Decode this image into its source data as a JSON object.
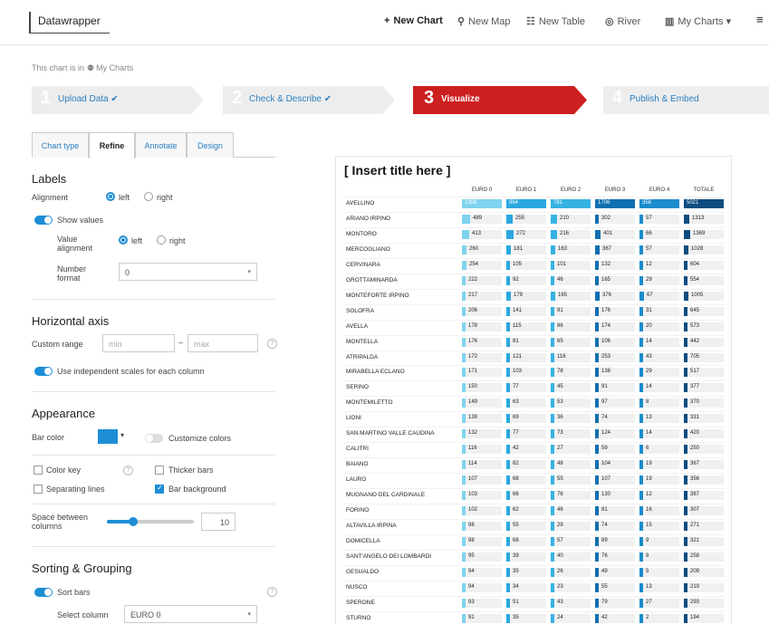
{
  "header": {
    "logo": "Datawrapper",
    "nav": [
      {
        "icon": "+",
        "label": "New Chart"
      },
      {
        "icon": "⚲",
        "label": "New Map"
      },
      {
        "icon": "☷",
        "label": "New Table"
      },
      {
        "icon": "◎",
        "label": "River"
      },
      {
        "icon": "▥",
        "label": "My Charts ▾"
      },
      {
        "icon": "≡",
        "label": ""
      }
    ]
  },
  "breadcrumb": {
    "prefix": "This chart is in",
    "icon": "⚉",
    "folder": "My Charts"
  },
  "steps": [
    {
      "num": "1",
      "label": "Upload Data ✔"
    },
    {
      "num": "2",
      "label": "Check & Describe ✔"
    },
    {
      "num": "3",
      "label": "Visualize"
    },
    {
      "num": "4",
      "label": "Publish & Embed"
    }
  ],
  "tabs": [
    "Chart type",
    "Refine",
    "Annotate",
    "Design"
  ],
  "labels": {
    "title": "Labels",
    "alignment_label": "Alignment",
    "left": "left",
    "right": "right",
    "show_values": "Show values",
    "value_alignment_label": "Value alignment",
    "number_format_label": "Number format",
    "number_format_value": "0"
  },
  "horizontal_axis": {
    "title": "Horizontal axis",
    "custom_range_label": "Custom range",
    "min_placeholder": "min",
    "max_placeholder": "max",
    "range_sep": "–",
    "independent_scales": "Use independent scales for each column"
  },
  "appearance": {
    "title": "Appearance",
    "bar_color_label": "Bar color",
    "bar_color": "#1d8ed6",
    "customize_colors": "Customize colors",
    "color_key": "Color key",
    "thicker_bars": "Thicker bars",
    "separating_lines": "Separating lines",
    "bar_background": "Bar background",
    "space_between_label": "Space between columns",
    "space_between_value": "10",
    "space_between_level": 0.3
  },
  "sorting": {
    "title": "Sorting & Grouping",
    "sort_bars": "Sort bars",
    "select_column_label": "Select column",
    "select_column_value": "EURO 0"
  },
  "help_glyph": "?",
  "caret": "▾",
  "chart_data": {
    "type": "table",
    "title": "[ Insert title here ]",
    "columns": [
      "EURO 0",
      "EURO 1",
      "EURO 2",
      "EURO 3",
      "EURO 4",
      "TOTALE"
    ],
    "column_colors": [
      "#7fd3ee",
      "#2aa8df",
      "#35b2e2",
      "#0f6fb0",
      "#1b8ccc",
      "#0d4d80"
    ],
    "rows": [
      {
        "name": "AVELLINO",
        "values": [
          1308,
          864,
          781,
          1706,
          358,
          5021
        ]
      },
      {
        "name": "ARIANO IRPINO",
        "values": [
          489,
          255,
          210,
          302,
          57,
          1313
        ]
      },
      {
        "name": "MONTORO",
        "values": [
          413,
          272,
          216,
          401,
          66,
          1369
        ]
      },
      {
        "name": "MERCOGLIANO",
        "values": [
          260,
          181,
          163,
          367,
          57,
          1028
        ]
      },
      {
        "name": "CERVINARA",
        "values": [
          254,
          105,
          101,
          132,
          12,
          604
        ]
      },
      {
        "name": "GROTTAMINARDA",
        "values": [
          222,
          92,
          46,
          165,
          29,
          554
        ]
      },
      {
        "name": "MONTEFORTE IRPINO",
        "values": [
          217,
          179,
          165,
          376,
          67,
          1005
        ]
      },
      {
        "name": "SOLOFRA",
        "values": [
          206,
          141,
          91,
          176,
          31,
          645
        ]
      },
      {
        "name": "AVELLA",
        "values": [
          178,
          115,
          86,
          174,
          20,
          573
        ]
      },
      {
        "name": "MONTELLA",
        "values": [
          176,
          81,
          65,
          106,
          14,
          442
        ]
      },
      {
        "name": "ATRIPALDA",
        "values": [
          172,
          121,
          116,
          253,
          43,
          705
        ]
      },
      {
        "name": "MIRABELLA ECLANO",
        "values": [
          171,
          103,
          78,
          136,
          29,
          517
        ]
      },
      {
        "name": "SERINO",
        "values": [
          150,
          77,
          45,
          91,
          14,
          377
        ]
      },
      {
        "name": "MONTEMILETTO",
        "values": [
          149,
          63,
          53,
          97,
          8,
          370
        ]
      },
      {
        "name": "LIONI",
        "values": [
          139,
          69,
          36,
          74,
          13,
          331
        ]
      },
      {
        "name": "SAN MARTINO VALLE CAUDINA",
        "values": [
          132,
          77,
          73,
          124,
          14,
          420
        ]
      },
      {
        "name": "CALITRI",
        "values": [
          116,
          42,
          27,
          59,
          6,
          250
        ]
      },
      {
        "name": "BAIANO",
        "values": [
          114,
          82,
          48,
          104,
          19,
          367
        ]
      },
      {
        "name": "LAURO",
        "values": [
          107,
          68,
          55,
          107,
          19,
          356
        ]
      },
      {
        "name": "MUGNANO DEL CARDINALE",
        "values": [
          103,
          66,
          76,
          130,
          12,
          387
        ]
      },
      {
        "name": "FORINO",
        "values": [
          102,
          62,
          46,
          81,
          16,
          307
        ]
      },
      {
        "name": "ALTAVILLA IRPINA",
        "values": [
          98,
          55,
          29,
          74,
          15,
          271
        ]
      },
      {
        "name": "DOMICELLA",
        "values": [
          98,
          68,
          57,
          89,
          9,
          321
        ]
      },
      {
        "name": "SANT'ANGELO DEI LOMBARDI",
        "values": [
          95,
          39,
          40,
          76,
          8,
          258
        ]
      },
      {
        "name": "GESUALDO",
        "values": [
          94,
          35,
          26,
          49,
          5,
          209
        ]
      },
      {
        "name": "NUSCO",
        "values": [
          94,
          34,
          23,
          55,
          13,
          219
        ]
      },
      {
        "name": "SPERONE",
        "values": [
          93,
          51,
          43,
          79,
          27,
          293
        ]
      },
      {
        "name": "STURNO",
        "values": [
          91,
          35,
          24,
          42,
          2,
          194
        ]
      }
    ]
  }
}
